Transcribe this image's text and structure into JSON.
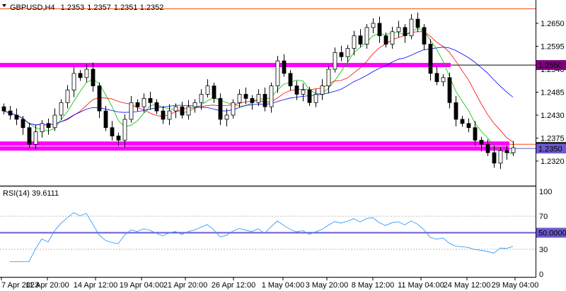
{
  "header": {
    "symbol": "GBPUSD,H4",
    "open": "1.2353",
    "high": "1.2357",
    "low": "1.2351",
    "close": "1.2352"
  },
  "rsi": {
    "label": "RSI(14) 39.6111",
    "levels": [
      "100",
      "70",
      "50.0000",
      "30",
      "0"
    ]
  },
  "colors": {
    "magenta": "#ff00ff",
    "label_purple": "#800080",
    "label_blue": "#6a5acd",
    "orange": "#ff4500",
    "ma_fast": "#00c000",
    "ma_mid": "#ff0000",
    "ma_slow": "#0000ff",
    "rsi": "#1e90ff"
  },
  "chart_data": {
    "type": "candlestick",
    "title": "GBPUSD,H4",
    "price_ticks": [
      "1.2650",
      "1.2595",
      "1.2540",
      "1.2485",
      "1.2430",
      "1.2375",
      "1.2320"
    ],
    "price_tick_values": [
      1.265,
      1.2595,
      1.254,
      1.2485,
      1.243,
      1.2375,
      1.232
    ],
    "ylim": [
      1.2305,
      1.2705
    ],
    "levels": {
      "resistance": 1.255,
      "resistance_label": "1.2550",
      "support": 1.235,
      "support_label": "1.2350",
      "top_line": 1.2685
    },
    "time_labels": [
      "7 Apr 2023",
      "11 Apr 20:00",
      "14 Apr 12:00",
      "19 Apr 04:00",
      "21 Apr 20:00",
      "26 Apr 12:00",
      "1 May 04:00",
      "3 May 20:00",
      "8 May 12:00",
      "11 May 04:00",
      "24 May 12:00",
      "29 May 04:00"
    ],
    "closes": [
      1.244,
      1.243,
      1.242,
      1.24,
      1.236,
      1.239,
      1.241,
      1.24,
      1.243,
      1.246,
      1.249,
      1.253,
      1.252,
      1.254,
      1.25,
      1.244,
      1.24,
      1.238,
      1.237,
      1.242,
      1.246,
      1.245,
      1.247,
      1.246,
      1.244,
      1.242,
      1.244,
      1.245,
      1.243,
      1.245,
      1.246,
      1.248,
      1.25,
      1.247,
      1.242,
      1.243,
      1.246,
      1.248,
      1.247,
      1.246,
      1.248,
      1.245,
      1.25,
      1.256,
      1.253,
      1.25,
      1.248,
      1.249,
      1.246,
      1.248,
      1.25,
      1.254,
      1.258,
      1.257,
      1.259,
      1.262,
      1.26,
      1.264,
      1.265,
      1.262,
      1.26,
      1.263,
      1.264,
      1.262,
      1.266,
      1.264,
      1.26,
      1.253,
      1.251,
      1.252,
      1.246,
      1.242,
      1.241,
      1.24,
      1.237,
      1.236,
      1.234,
      1.2315,
      1.2345,
      1.234,
      1.2352
    ]
  }
}
